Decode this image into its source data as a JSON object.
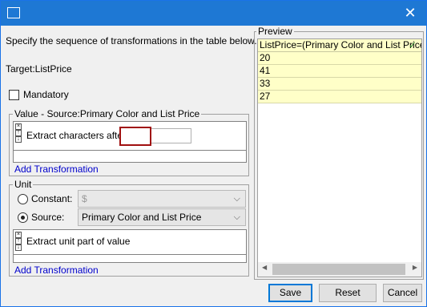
{
  "title_bar": {
    "close_glyph": "✕"
  },
  "instructions": "Specify the sequence of transformations in the table below.",
  "target": "Target:ListPrice",
  "mandatory_label": "Mandatory",
  "value_group": {
    "title": "Value - Source:Primary Color and List Price",
    "transform_label": "Extract characters after",
    "transform_value": "",
    "add_link": "Add Transformation"
  },
  "unit_group": {
    "title": "Unit",
    "constant_label": "Constant:",
    "constant_value": "$",
    "source_label": "Source:",
    "source_value": "Primary Color and List Price",
    "transform_label": "Extract unit part of value",
    "add_link": "Add Transformation"
  },
  "preview": {
    "title": "Preview",
    "header": "ListPrice=(Primary Color and List Price)",
    "header_check": "✓",
    "rows": [
      "20",
      "41",
      "33",
      "27"
    ]
  },
  "buttons": {
    "save": "Save",
    "reset": "Reset",
    "cancel": "Cancel"
  },
  "colors": {
    "titlebar": "#1e78d4",
    "highlight_box": "#a01010",
    "preview_row": "#ffffc8",
    "link": "#0000cc"
  }
}
